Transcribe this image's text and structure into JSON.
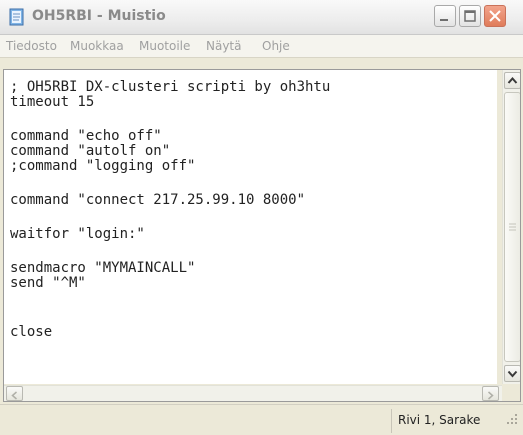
{
  "window": {
    "title": "OH5RBI - Muistio",
    "controls": {
      "minimize": "minimize",
      "maximize": "maximize",
      "close": "close"
    }
  },
  "colors": {
    "titlebar": "#EDEDED",
    "close_button": "#E07C5A",
    "menu_text": "#A0A0A0",
    "editor_bg": "#FFFFFF"
  },
  "icons": {
    "app": "notepad-icon",
    "minimize": "minimize-icon",
    "maximize": "maximize-icon",
    "close": "close-icon",
    "scroll_up": "arrow-up-icon",
    "scroll_down": "arrow-down-icon",
    "scroll_left": "arrow-left-icon",
    "scroll_right": "arrow-right-icon",
    "resize": "resize-grip-icon"
  },
  "menu": [
    "Tiedosto",
    "Muokkaa",
    "Muotoile",
    "Näytä",
    "Ohje"
  ],
  "editor": {
    "lines": [
      "; OH5RBI DX-clusteri scripti by oh3htu",
      "timeout 15",
      "",
      "command \"echo off\"",
      "command \"autolf on\"",
      ";command \"logging off\"",
      "",
      "command \"connect 217.25.99.10 8000\"",
      "",
      "waitfor \"login:\"",
      "",
      "sendmacro \"MYMAINCALL\"",
      "send \"^M\"",
      "",
      "",
      "close"
    ]
  },
  "status": {
    "position": "Rivi 1, Sarake"
  }
}
